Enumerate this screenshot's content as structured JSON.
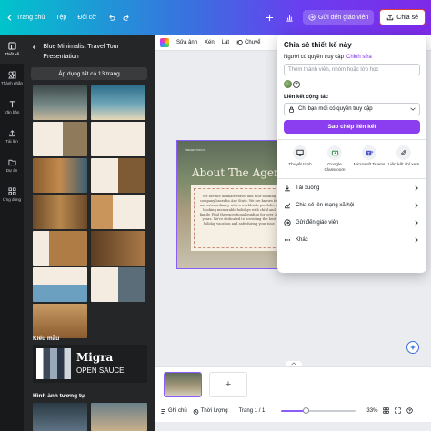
{
  "topbar": {
    "home_label": "Trang chủ",
    "file_label": "Tệp",
    "resize_label": "Đổi cỡ",
    "undo_icon": "undo-icon",
    "redo_icon": "redo-icon",
    "send_label": "Gửi đến giáo viên",
    "share_label": "Chia sẻ"
  },
  "rail": {
    "items": [
      {
        "label": "Thiết kế",
        "icon": "layout-icon"
      },
      {
        "label": "Thành phần",
        "icon": "elements-icon"
      },
      {
        "label": "Văn bản",
        "icon": "text-icon"
      },
      {
        "label": "Tải lên",
        "icon": "upload-icon"
      },
      {
        "label": "Dự án",
        "icon": "folder-icon"
      },
      {
        "label": "Ứng dụng",
        "icon": "apps-icon"
      }
    ]
  },
  "panel": {
    "title": "Blue Minimalist Travel Tour Presentation",
    "apply_all": "Áp dụng tất cả 13 trang",
    "styles_label": "Kiểu mẫu",
    "similar_label": "Hình ảnh tương tự",
    "migra_title": "Migra",
    "migra_subtitle": "OPEN SAUCE"
  },
  "toolbar2": {
    "edit_image": "Sửa ảnh",
    "crop": "Xén",
    "flip": "Lật",
    "animate": "Chuyể"
  },
  "slide": {
    "label": "PRESENTATION",
    "title": "About The Agency",
    "body": "We are the ultimate travel and tour booking company based in Any State. We are known for our extraordinary with a worldwide portfolio of booking memorable holidays with child and family. Find the exceptional guiding for over 20 years. We're dedicated to providing the best holiday vacation and safe during your tour."
  },
  "share": {
    "title": "Chia sẻ thiết kế này",
    "access_label": "Người có quyền truy cập",
    "edit_link": "Chỉnh sửa",
    "input_placeholder": "Thêm thành viên, nhóm hoặc lớp học",
    "collab_label": "Liên kết cộng tác",
    "access_option": "Chỉ bạn mới có quyền truy cập",
    "copy_label": "Sao chép liên kết",
    "targets": [
      {
        "label": "Thuyết trình",
        "icon": "present-icon"
      },
      {
        "label": "Google Classroom",
        "icon": "google-classroom-icon"
      },
      {
        "label": "Microsoft Teams",
        "icon": "teams-icon"
      },
      {
        "label": "Liên kết chỉ xem",
        "icon": "link-icon"
      }
    ],
    "actions": [
      {
        "label": "Tải xuống",
        "icon": "download-icon"
      },
      {
        "label": "Chia sẻ lên mạng xã hội",
        "icon": "social-share-icon"
      },
      {
        "label": "Gửi đến giáo viên",
        "icon": "send-teacher-icon"
      },
      {
        "label": "Khác",
        "icon": "more-icon"
      }
    ]
  },
  "statusbar": {
    "notes": "Ghi chú",
    "timing": "Thời lượng",
    "page": "Trang 1 / 1",
    "zoom": "33%",
    "zoom_fraction": 0.33
  },
  "colors": {
    "accent": "#8b3df0",
    "topbar_start": "#00c4cc",
    "topbar_end": "#7d2ae8",
    "panel_bg": "#252627"
  }
}
